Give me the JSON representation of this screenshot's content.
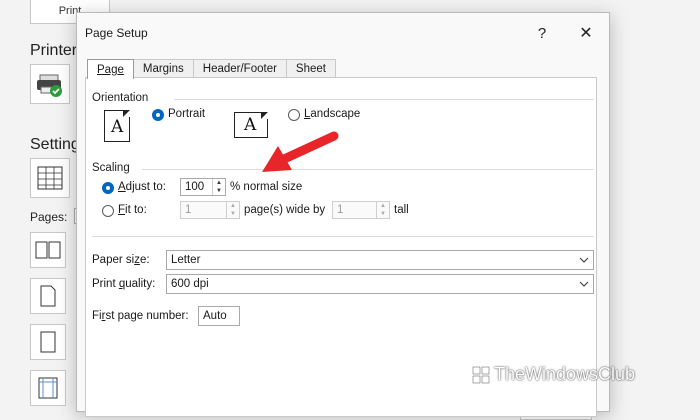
{
  "background": {
    "print_button_label": "Print",
    "printer_heading": "Printer",
    "settings_heading": "Setting",
    "pages_label": "Pages:"
  },
  "dialog": {
    "title": "Page Setup",
    "help_label": "?",
    "close_label": "✕",
    "tabs": [
      {
        "label": "Page",
        "active": true
      },
      {
        "label": "Margins",
        "active": false
      },
      {
        "label": "Header/Footer",
        "active": false
      },
      {
        "label": "Sheet",
        "active": false
      }
    ],
    "orientation": {
      "group_label": "Orientation",
      "portrait_pre": "",
      "portrait_u": "T",
      "portrait_post": "Portrait",
      "landscape_u": "L",
      "landscape_post": "andscape",
      "icon_letter": "A",
      "selected": "portrait"
    },
    "scaling": {
      "group_label": "Scaling",
      "adjust_u": "A",
      "adjust_post": "djust to:",
      "adjust_value": "100",
      "adjust_suffix": "% normal size",
      "fit_u": "F",
      "fit_post": "it to:",
      "fit_wide_value": "1",
      "fit_wide_suffix": "page(s) wide by",
      "fit_tall_value": "1",
      "fit_tall_suffix": "tall",
      "selected": "adjust"
    },
    "paper_size": {
      "label_pre": "Paper si",
      "label_u": "z",
      "label_post": "e:",
      "value": "Letter"
    },
    "print_quality": {
      "label_pre": "Print ",
      "label_u": "q",
      "label_post": "uality:",
      "value": "600 dpi"
    },
    "first_page_number": {
      "label_pre": "Fi",
      "label_u": "r",
      "label_post": "st page number:",
      "value": "Auto"
    }
  },
  "watermark": {
    "text": "TheWindowsClub"
  },
  "colors": {
    "accent": "#0067c0",
    "arrow": "#e8262a"
  }
}
